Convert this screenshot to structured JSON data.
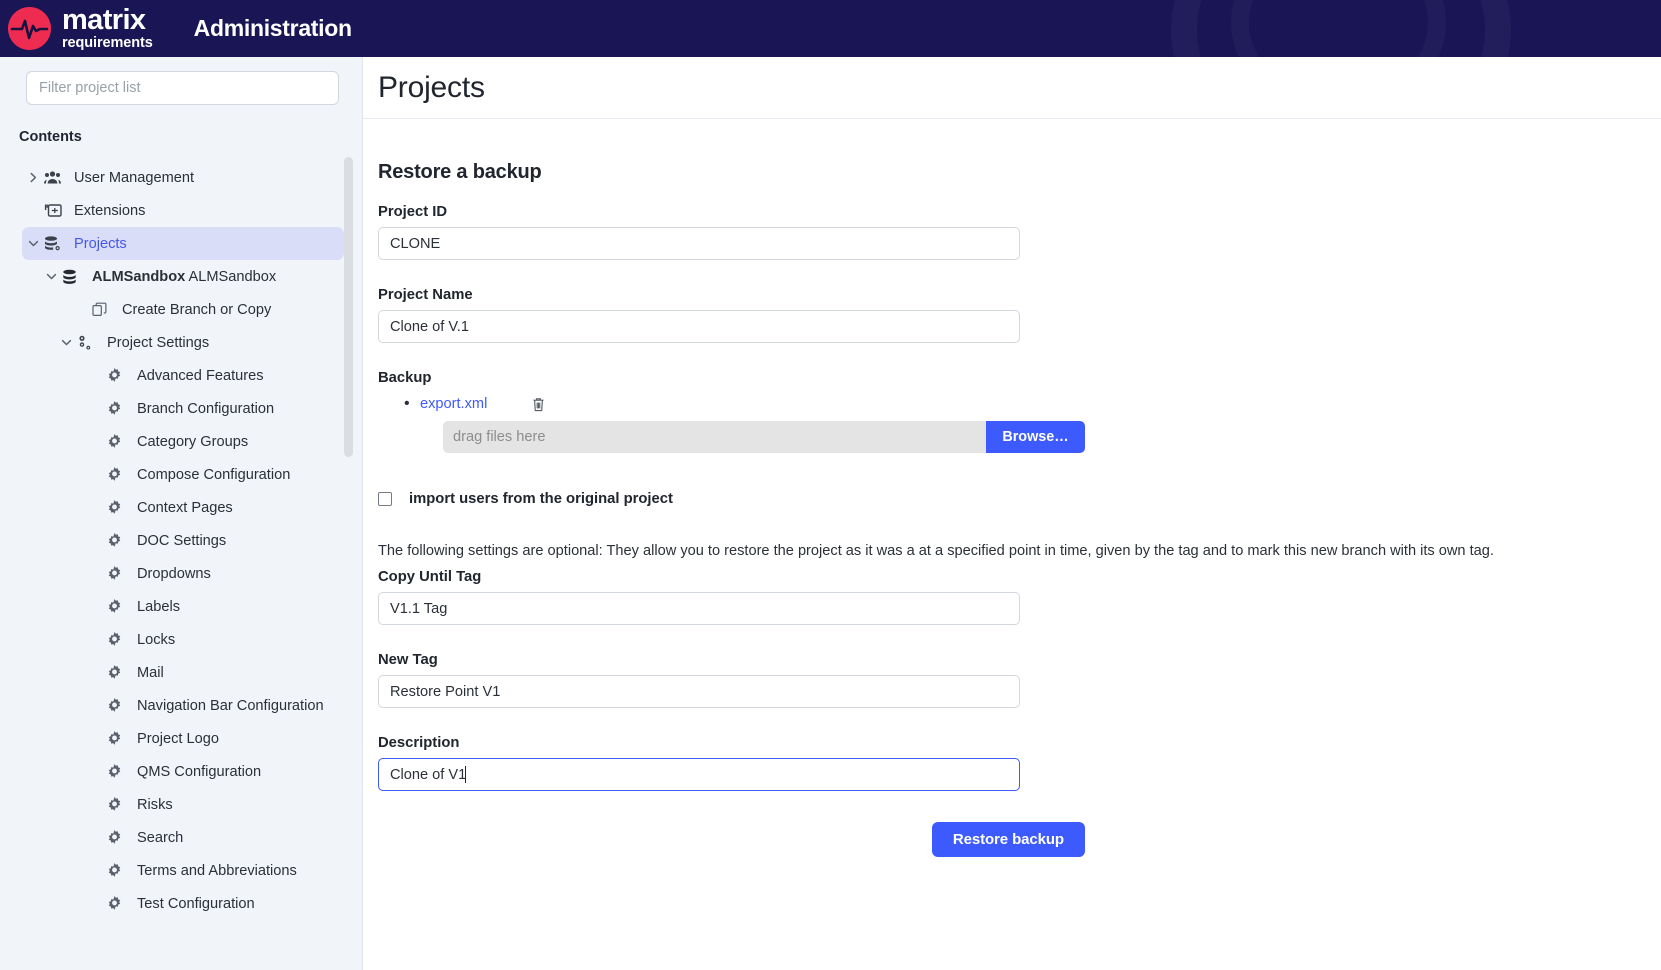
{
  "header": {
    "brand_line1": "matrix",
    "brand_line2": "requirements",
    "app_title": "Administration",
    "brand_color": "#ee2c52",
    "bar_color": "#1a1555"
  },
  "sidebar": {
    "filter_placeholder": "Filter project list",
    "filter_value": "",
    "contents_label": "Contents",
    "items": [
      {
        "label": "User Management",
        "icon": "users-icon",
        "chevron": "right",
        "indent": 0,
        "active": false
      },
      {
        "label": "Extensions",
        "icon": "extensions-icon",
        "chevron": "none",
        "indent": 0,
        "active": false
      },
      {
        "label": "Projects",
        "icon": "database-gear-icon",
        "chevron": "down",
        "indent": 0,
        "active": true
      },
      {
        "label": "ALMSandbox",
        "sub_label": "ALMSandbox",
        "icon": "database-icon",
        "chevron": "down",
        "indent": 1,
        "active": false
      },
      {
        "label": "Create Branch or Copy",
        "icon": "copy-icon",
        "chevron": "none",
        "indent": 2,
        "active": false
      },
      {
        "label": "Project Settings",
        "icon": "settings-branch-icon",
        "chevron": "down",
        "indent": 3,
        "active": false
      },
      {
        "label": "Advanced Features",
        "icon": "gear-icon",
        "chevron": "none",
        "indent": 4,
        "active": false
      },
      {
        "label": "Branch Configuration",
        "icon": "gear-icon",
        "chevron": "none",
        "indent": 4,
        "active": false
      },
      {
        "label": "Category Groups",
        "icon": "gear-icon",
        "chevron": "none",
        "indent": 4,
        "active": false
      },
      {
        "label": "Compose Configuration",
        "icon": "gear-icon",
        "chevron": "none",
        "indent": 4,
        "active": false
      },
      {
        "label": "Context Pages",
        "icon": "gear-icon",
        "chevron": "none",
        "indent": 4,
        "active": false
      },
      {
        "label": "DOC Settings",
        "icon": "gear-icon",
        "chevron": "none",
        "indent": 4,
        "active": false
      },
      {
        "label": "Dropdowns",
        "icon": "gear-icon",
        "chevron": "none",
        "indent": 4,
        "active": false
      },
      {
        "label": "Labels",
        "icon": "gear-icon",
        "chevron": "none",
        "indent": 4,
        "active": false
      },
      {
        "label": "Locks",
        "icon": "gear-icon",
        "chevron": "none",
        "indent": 4,
        "active": false
      },
      {
        "label": "Mail",
        "icon": "gear-icon",
        "chevron": "none",
        "indent": 4,
        "active": false
      },
      {
        "label": "Navigation Bar Configuration",
        "icon": "gear-icon",
        "chevron": "none",
        "indent": 4,
        "active": false
      },
      {
        "label": "Project Logo",
        "icon": "gear-icon",
        "chevron": "none",
        "indent": 4,
        "active": false
      },
      {
        "label": "QMS Configuration",
        "icon": "gear-icon",
        "chevron": "none",
        "indent": 4,
        "active": false
      },
      {
        "label": "Risks",
        "icon": "gear-icon",
        "chevron": "none",
        "indent": 4,
        "active": false
      },
      {
        "label": "Search",
        "icon": "gear-icon",
        "chevron": "none",
        "indent": 4,
        "active": false
      },
      {
        "label": "Terms and Abbreviations",
        "icon": "gear-icon",
        "chevron": "none",
        "indent": 4,
        "active": false
      },
      {
        "label": "Test Configuration",
        "icon": "gear-icon",
        "chevron": "none",
        "indent": 4,
        "active": false
      }
    ]
  },
  "main": {
    "page_title": "Projects",
    "section_title": "Restore a backup",
    "project_id": {
      "label": "Project ID",
      "value": "CLONE"
    },
    "project_name": {
      "label": "Project Name",
      "value": "Clone of V.1"
    },
    "backup": {
      "label": "Backup",
      "file_name": "export.xml",
      "delete_icon": "trash-icon",
      "drop_placeholder": "drag files here",
      "browse_label": "Browse…"
    },
    "import_users": {
      "label": "import users from the original project",
      "checked": false
    },
    "optional_note": "The following settings are optional: They allow you to restore the project as it was a at a specified point in time, given by the tag and to mark this new branch with its own tag.",
    "copy_until_tag": {
      "label": "Copy Until Tag",
      "value": "V1.1 Tag"
    },
    "new_tag": {
      "label": "New Tag",
      "value": "Restore Point V1"
    },
    "description": {
      "label": "Description",
      "value": "Clone of V1",
      "focused": true
    },
    "submit_label": "Restore backup",
    "accent_color": "#3d5afe"
  }
}
